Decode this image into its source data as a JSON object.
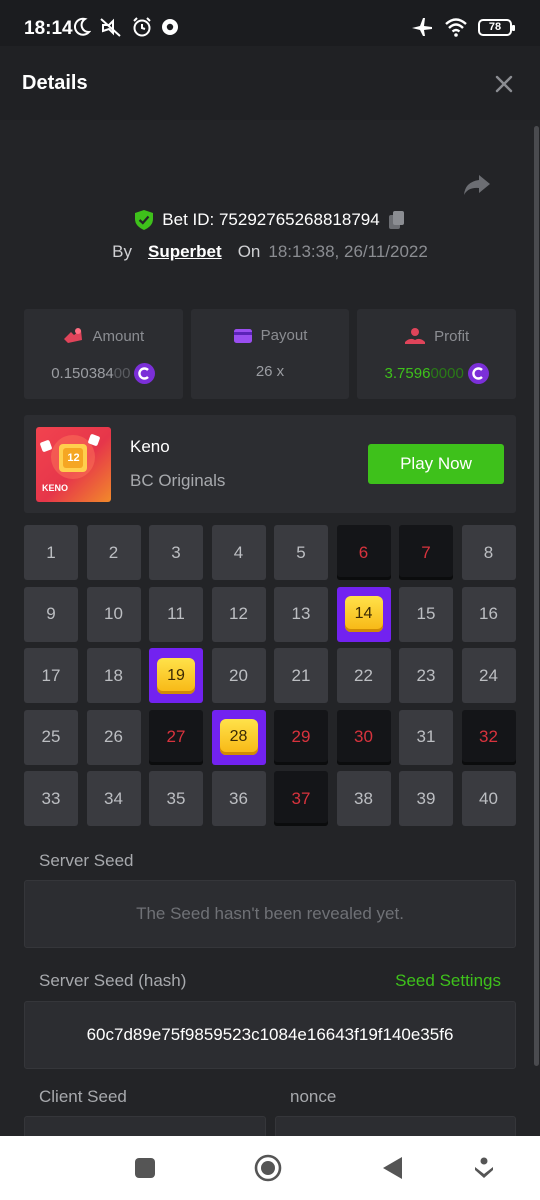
{
  "status_bar": {
    "time": "18:14",
    "battery": "78",
    "icons": [
      "moon-icon",
      "mute-icon",
      "alarm-icon",
      "chrome-icon",
      "airplane-icon",
      "wifi-icon",
      "battery-icon"
    ]
  },
  "header": {
    "title": "Details",
    "close_icon": "close-icon"
  },
  "bet": {
    "id_label": "Bet ID: 75292765268818794",
    "by_label": "By",
    "author": "Superbet",
    "on_label": "On",
    "datetime": "18:13:38, 26/11/2022"
  },
  "stats": {
    "amount": {
      "label": "Amount",
      "value_main": "0.150384",
      "value_trail": "00"
    },
    "payout": {
      "label": "Payout",
      "value": "26 x"
    },
    "profit": {
      "label": "Profit",
      "value_main": "3.7596",
      "value_trail": "0000"
    }
  },
  "game": {
    "title": "Keno",
    "provider": "BC Originals",
    "thumb_text": "KENO",
    "thumb_number": "12",
    "play_label": "Play Now"
  },
  "keno": {
    "numbers": [
      "1",
      "2",
      "3",
      "4",
      "5",
      "6",
      "7",
      "8",
      "9",
      "10",
      "11",
      "12",
      "13",
      "14",
      "15",
      "16",
      "17",
      "18",
      "19",
      "20",
      "21",
      "22",
      "23",
      "24",
      "25",
      "26",
      "27",
      "28",
      "29",
      "30",
      "31",
      "32",
      "33",
      "34",
      "35",
      "36",
      "37",
      "38",
      "39",
      "40"
    ],
    "states": [
      "n",
      "n",
      "n",
      "n",
      "n",
      "miss",
      "miss",
      "n",
      "n",
      "n",
      "n",
      "n",
      "n",
      "hit",
      "n",
      "n",
      "n",
      "n",
      "hit",
      "n",
      "n",
      "n",
      "n",
      "n",
      "n",
      "n",
      "miss",
      "hit",
      "miss",
      "miss",
      "n",
      "miss",
      "n",
      "n",
      "n",
      "n",
      "miss",
      "n",
      "n",
      "n"
    ]
  },
  "seeds": {
    "server_seed_label": "Server Seed",
    "server_seed_value": "The Seed hasn't been revealed yet.",
    "server_hash_label": "Server Seed (hash)",
    "seed_settings": "Seed Settings",
    "server_hash_value": "60c7d89e75f9859523c1084e16643f19f140e35f6",
    "client_seed_label": "Client Seed",
    "nonce_label": "nonce"
  },
  "colors": {
    "accent_green": "#3ec11b",
    "hit_purple": "#7222f0",
    "miss_red": "#d8333d",
    "coin_purple": "#7b2fd8"
  }
}
